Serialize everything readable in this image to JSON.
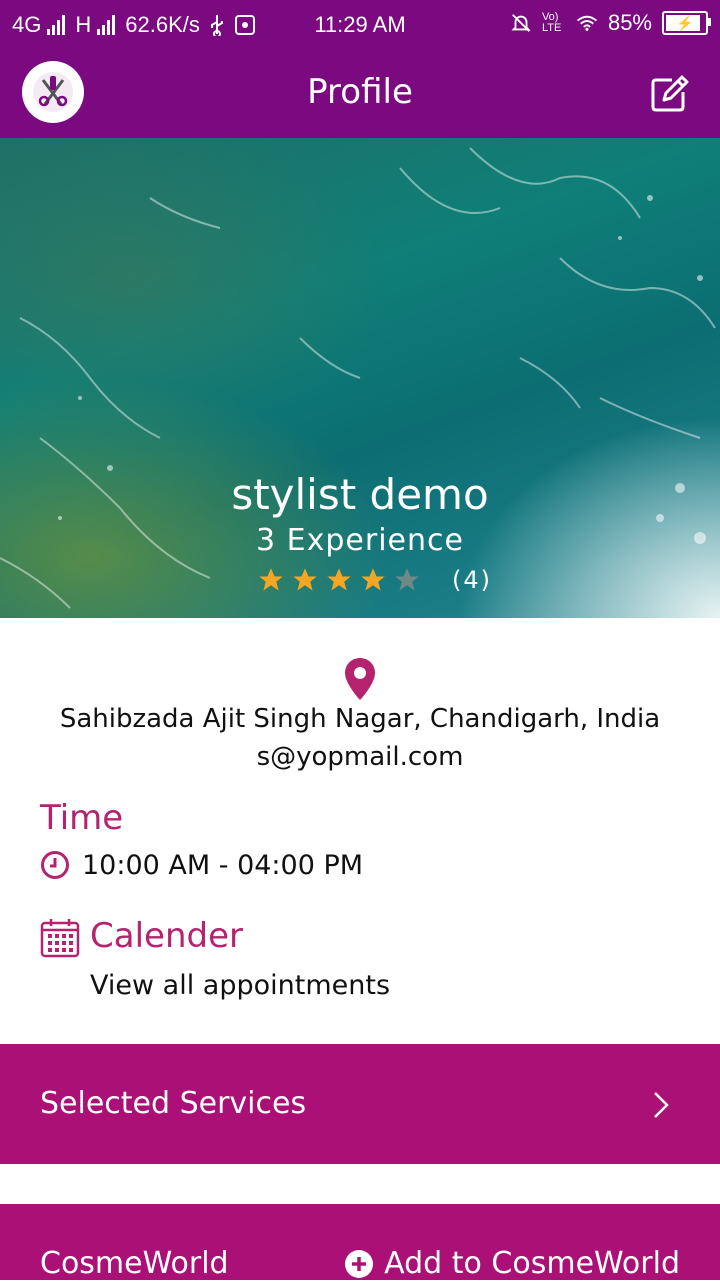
{
  "status_bar": {
    "network_left": "4G",
    "network_mid": "H",
    "speed": "62.6K/s",
    "time": "11:29 AM",
    "volte": "Vo) LTE",
    "battery": "85%"
  },
  "app_bar": {
    "title": "Profile"
  },
  "profile": {
    "name": "stylist demo",
    "experience": "3 Experience",
    "rating": 4,
    "rating_max": 5,
    "rating_count": "(4)",
    "address": "Sahibzada Ajit Singh Nagar, Chandigarh, India",
    "email": "s@yopmail.com"
  },
  "time": {
    "heading": "Time",
    "value": "10:00 AM - 04:00 PM"
  },
  "calendar": {
    "heading": "Calender",
    "link": "View all appointments"
  },
  "services": {
    "label": "Selected Services"
  },
  "cosmeworld": {
    "label": "CosmeWorld",
    "add_label": "Add to CosmeWorld"
  },
  "colors": {
    "primary": "#7b0a81",
    "accent": "#b5236f",
    "section_bg": "#ab1076",
    "star": "#f5a623"
  }
}
